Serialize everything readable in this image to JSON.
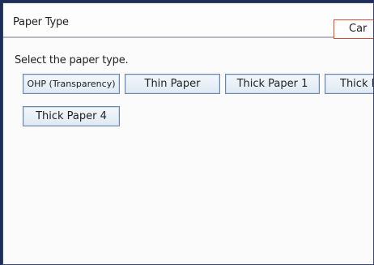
{
  "window": {
    "title": "Paper Type",
    "cancel_label": "Car"
  },
  "instruction": "Select the paper type.",
  "paper_types": [
    "OHP (Transparency)",
    "Thin Paper",
    "Thick Paper 1",
    "Thick Pa",
    "Thick Paper 4"
  ]
}
